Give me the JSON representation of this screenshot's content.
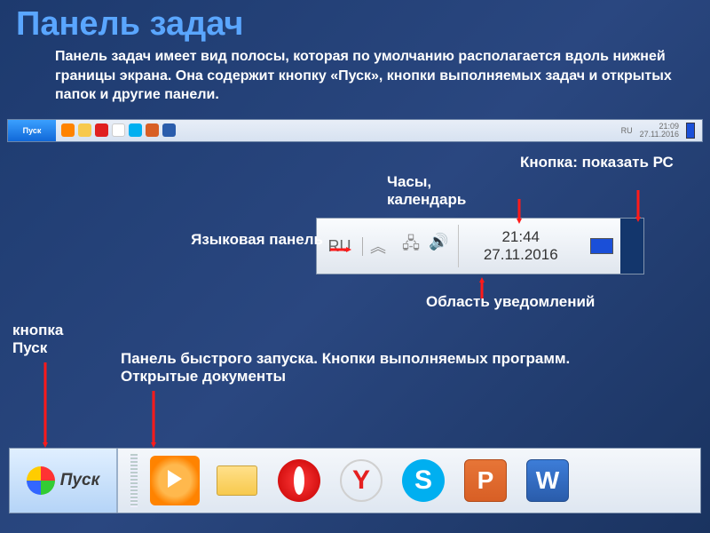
{
  "title": "Панель задач",
  "intro": "Панель задач имеет вид полосы, которая по умолчанию располагается вдоль нижней границы экрана. Она содержит кнопку «Пуск», кнопки выполняемых задач и открытых папок и другие панели.",
  "full_taskbar": {
    "start": "Пуск",
    "lang": "RU",
    "time": "21:09",
    "date": "27.11.2016"
  },
  "tray": {
    "lang": "RU",
    "chevron": "︽",
    "time": "21:44",
    "date": "27.11.2016"
  },
  "big_taskbar": {
    "start": "Пуск",
    "yandex": "Y",
    "skype": "S",
    "ppt": "P",
    "word": "W"
  },
  "labels": {
    "lang_panel": "Языковая панель",
    "clock_cal": "Часы, календарь",
    "show_desktop": "Кнопка: показать РС",
    "start_btn": "кнопка Пуск",
    "quicklaunch": "Панель быстрого запуска. Кнопки выполняемых программ. Открытые документы",
    "notify_area": "Область уведомлений"
  },
  "icon_colors": {
    "wmp": "#ff8300",
    "folder": "#f7c94d",
    "opera": "#e02020",
    "yandex_border": "#d0d0d0",
    "yandex_text": "#e52020",
    "skype": "#00aff0",
    "ppt": "#d85f25",
    "word": "#2a5cab"
  }
}
